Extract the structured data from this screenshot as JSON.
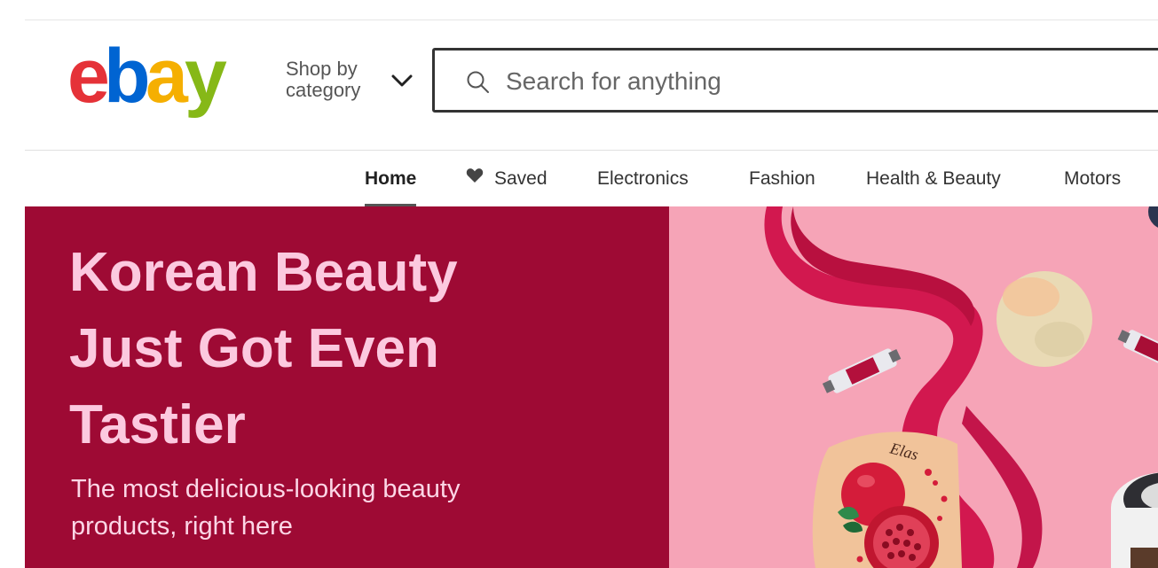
{
  "header": {
    "logo_text": "ebay",
    "shop_by_category": {
      "line1": "Shop by",
      "line2": "category"
    },
    "search": {
      "placeholder": "Search for anything"
    }
  },
  "nav": {
    "items": [
      {
        "label": "Home",
        "active": true
      },
      {
        "label": "Saved",
        "icon": "heart-icon"
      },
      {
        "label": "Electronics"
      },
      {
        "label": "Fashion"
      },
      {
        "label": "Health & Beauty"
      },
      {
        "label": "Motors"
      }
    ]
  },
  "hero": {
    "title_lines": [
      "Korean Beauty",
      "Just Got Even",
      "Tastier"
    ],
    "subtitle_lines": [
      "The most delicious-looking beauty",
      "products, right here"
    ],
    "product_label": "Elas",
    "colors": {
      "left_bg": "#9e0a34",
      "title": "#fcc9df",
      "right_bg": "#f6a4b7"
    }
  },
  "colors": {
    "logo_e": "#e53238",
    "logo_b": "#0064d2",
    "logo_a": "#f5af02",
    "logo_y": "#86b817"
  }
}
